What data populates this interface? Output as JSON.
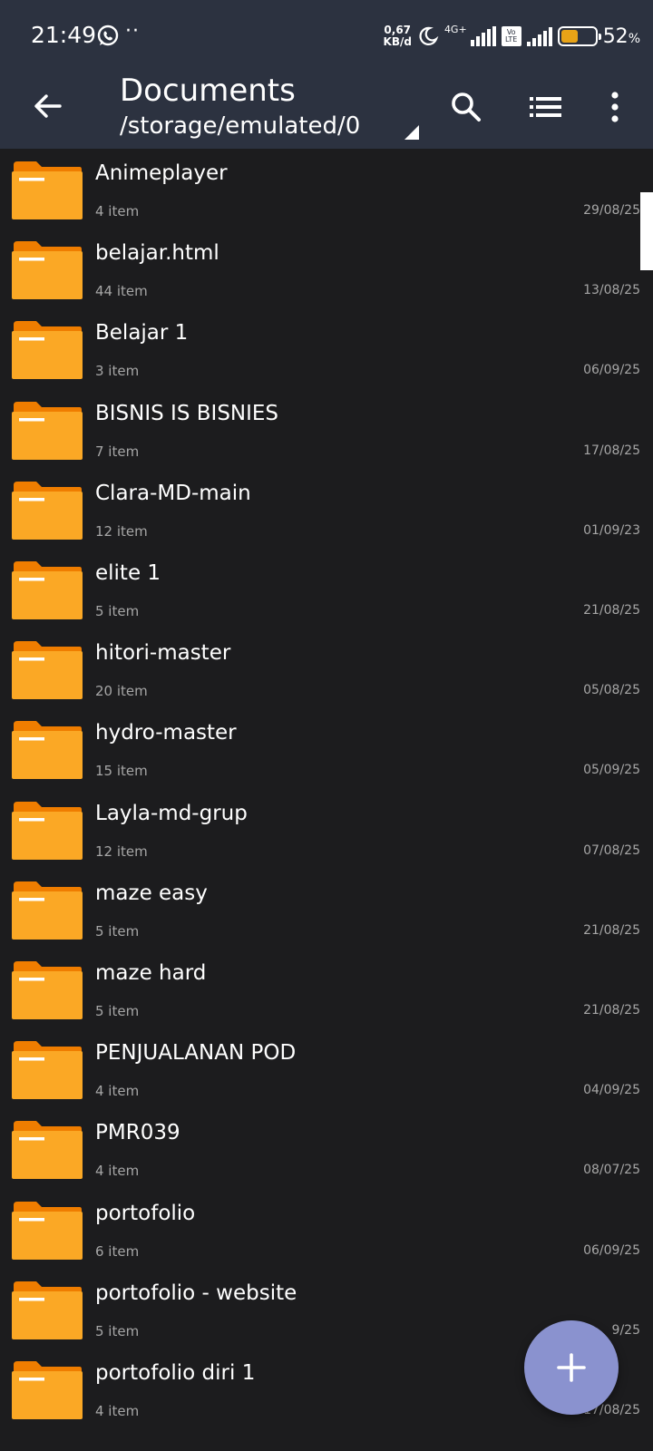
{
  "status": {
    "time": "21:49",
    "dots": "··",
    "netspeed_value": "0,67",
    "netspeed_unit": "KB/d",
    "network": "4G+",
    "volte_top": "Vo",
    "volte_bottom": "LTE",
    "battery_percent": "52",
    "battery_unit": "%",
    "battery_level": 0.52,
    "battery_color": "#e8a317"
  },
  "toolbar": {
    "title": "Documents",
    "path": "/storage/emulated/0",
    "back_icon": "arrow-left-icon",
    "search_icon": "search-icon",
    "view_icon": "list-view-icon",
    "more_icon": "more-vert-icon"
  },
  "colors": {
    "bar_bg": "#2c3240",
    "list_bg": "#1c1c1e",
    "folder_front": "#fba825",
    "folder_back": "#ef7d00",
    "fab": "#8a92cf"
  },
  "items": [
    {
      "name": "Animeplayer",
      "count": "4 item",
      "date": "29/08/25"
    },
    {
      "name": "belajar.html",
      "count": "44 item",
      "date": "13/08/25"
    },
    {
      "name": "Belajar 1",
      "count": "3 item",
      "date": "06/09/25"
    },
    {
      "name": "BISNIS IS BISNIES",
      "count": "7 item",
      "date": "17/08/25"
    },
    {
      "name": "Clara-MD-main",
      "count": "12 item",
      "date": "01/09/23"
    },
    {
      "name": "elite 1",
      "count": "5 item",
      "date": "21/08/25"
    },
    {
      "name": "hitori-master",
      "count": "20 item",
      "date": "05/08/25"
    },
    {
      "name": "hydro-master",
      "count": "15 item",
      "date": "05/09/25"
    },
    {
      "name": "Layla-md-grup",
      "count": "12 item",
      "date": "07/08/25"
    },
    {
      "name": "maze easy",
      "count": "5 item",
      "date": "21/08/25"
    },
    {
      "name": "maze hard",
      "count": "5 item",
      "date": "21/08/25"
    },
    {
      "name": "PENJUALANAN POD",
      "count": "4 item",
      "date": "04/09/25"
    },
    {
      "name": "PMR039",
      "count": "4 item",
      "date": "08/07/25"
    },
    {
      "name": "portofolio",
      "count": "6 item",
      "date": "06/09/25"
    },
    {
      "name": "portofolio - website",
      "count": "5 item",
      "date": "9/25"
    },
    {
      "name": "portofolio diri 1",
      "count": "4 item",
      "date": "17/08/25"
    }
  ],
  "fab": {
    "label": "+",
    "icon": "plus-icon"
  }
}
